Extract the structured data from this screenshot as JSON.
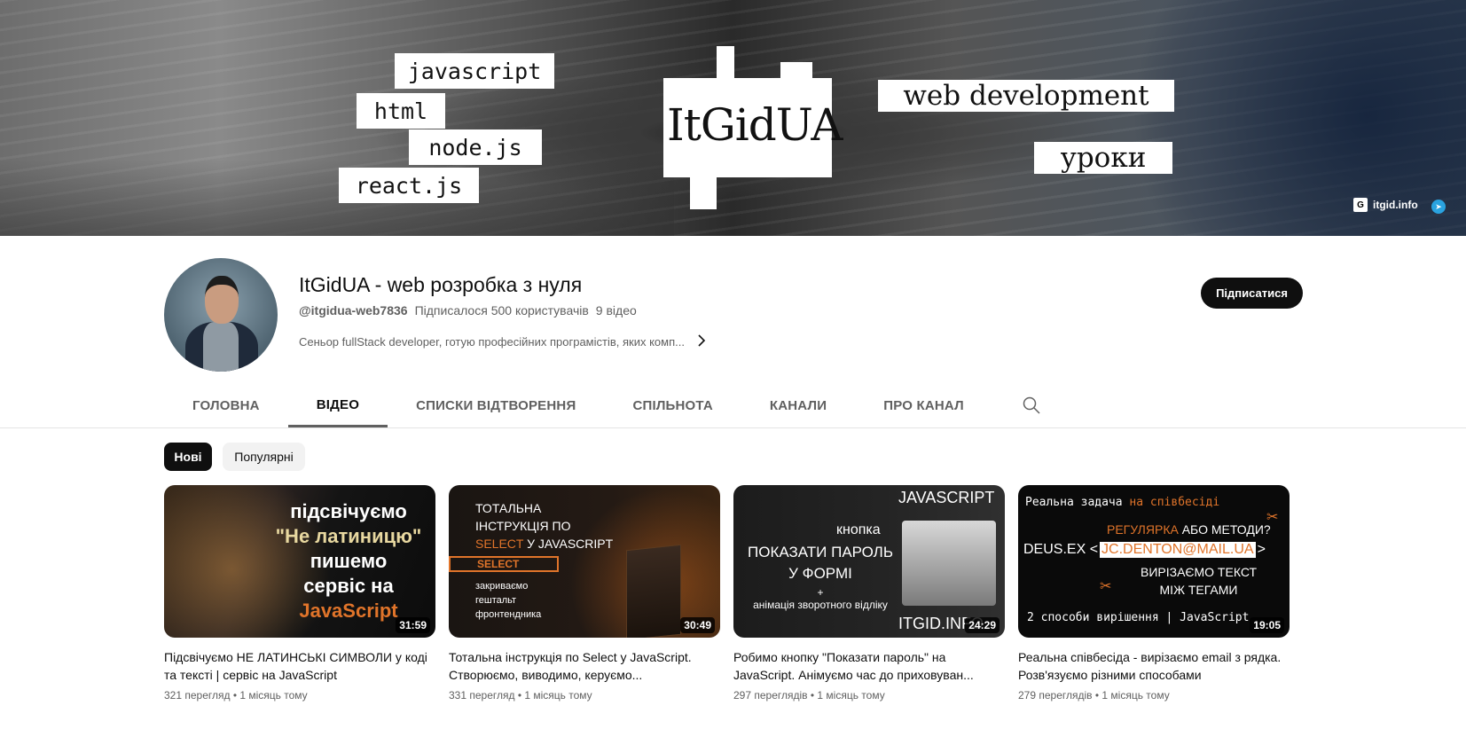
{
  "banner": {
    "tags": [
      "javascript",
      "html",
      "node.js",
      "react.js"
    ],
    "logo": "ItGidUA",
    "tagline": "web development",
    "subtitle": "уроки",
    "link_label": "itgid.info",
    "link_icon": "site-favicon-icon",
    "telegram_icon": "telegram-icon"
  },
  "channel": {
    "name": "ItGidUA - web розробка з нуля",
    "handle": "@itgidua-web7836",
    "subscribers": "Підписалося 500 користувачів",
    "videos": "9 відео",
    "description": "Сеньор fullStack developer, готую професійних програмістів, яких комп...",
    "subscribe_label": "Підписатися"
  },
  "tabs": [
    {
      "label": "ГОЛОВНА",
      "active": false
    },
    {
      "label": "ВІДЕО",
      "active": true
    },
    {
      "label": "СПИСКИ ВІДТВОРЕННЯ",
      "active": false
    },
    {
      "label": "СПІЛЬНОТА",
      "active": false
    },
    {
      "label": "КАНАЛИ",
      "active": false
    },
    {
      "label": "ПРО КАНАЛ",
      "active": false
    }
  ],
  "chips": [
    "Нові",
    "Популярні"
  ],
  "videos": [
    {
      "title": "Підсвічуємо НЕ ЛАТИНСЬКІ СИМВОЛИ у коді та тексті | сервіс на JavaScript",
      "meta": "321 перегляд • 1 місяць тому",
      "duration": "31:59",
      "thumb_text": [
        "підсвічуємо",
        "\"Не латиницю\"",
        "пишемо",
        "сервіс на",
        "JavaScript"
      ]
    },
    {
      "title": "Тотальна інструкція по Select у JavaScript. Створюємо, виводимо, керуємо...",
      "meta": "331 перегляд • 1 місяць тому",
      "duration": "30:49",
      "thumb_text": [
        "ТОТАЛЬНА",
        "ІНСТРУКЦІЯ ПО",
        "SELECT",
        "У JAVASCRIPT",
        "SELECT",
        "закриваємо",
        "гештальт",
        "фронтендника"
      ]
    },
    {
      "title": "Робимо кнопку \"Показати пароль\" на JavaScript. Анімуємо час до приховуван...",
      "meta": "297 переглядів • 1 місяць тому",
      "duration": "24:29",
      "thumb_text": [
        "JAVASCRIPT",
        "кнопка",
        "ПОКАЗАТИ ПАРОЛЬ",
        "У ФОРМІ",
        "+",
        "анімація зворотного відліку",
        "ITGID.INFO"
      ]
    },
    {
      "title": "Реальна співбесіда - вирізаємо email з рядка. Розв'язуємо різними способами",
      "meta": "279 переглядів • 1 місяць тому",
      "duration": "19:05",
      "thumb_text": [
        "Реальна задача",
        "на співбесіді",
        "РЕГУЛЯРКА",
        "АБО МЕТОДИ?",
        "DEUS.EX <",
        "JC.DENTON@MAIL.UA",
        ">",
        "ВИРІЗАЄМО ТЕКСТ",
        "МІЖ ТЕГАМИ",
        "2 способи вирішення | JavaScript"
      ]
    }
  ],
  "colors": {
    "accent_orange": "#e0742a",
    "subscribe_bg": "#0f0f0f"
  }
}
